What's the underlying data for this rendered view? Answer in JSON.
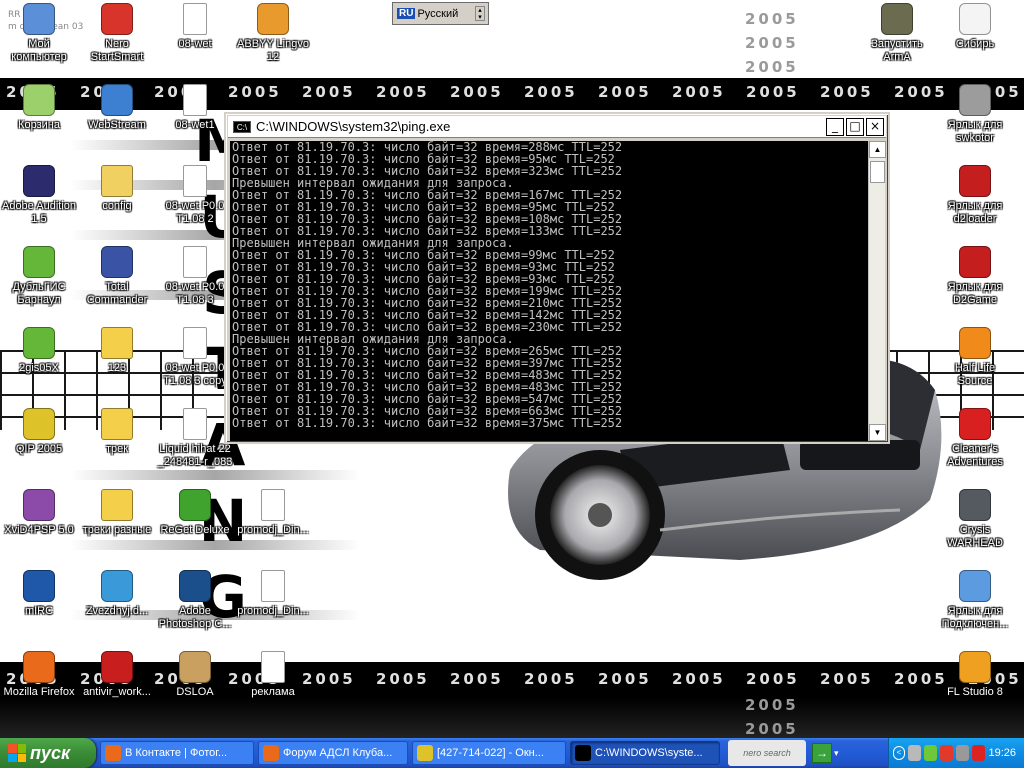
{
  "desktop": {
    "wallpaper": {
      "year_text": "2005",
      "mustang_letters": [
        "M",
        "U",
        "S",
        "T",
        "A",
        "N",
        "G"
      ],
      "corner_text_line1": "RR AZZO",
      "corner_text_line2": "m dof@drean 03"
    },
    "icons": [
      {
        "label": "Мой компьютер",
        "icon": "my-computer-icon"
      },
      {
        "label": "Nero StartSmart",
        "icon": "nero-icon"
      },
      {
        "label": "08-wet",
        "icon": "wav-file-icon"
      },
      {
        "label": "ABBYY Lingvo 12",
        "icon": "lingvo-books-icon"
      },
      {
        "label": "Запустить ArmA",
        "icon": "arma-soldier-icon"
      },
      {
        "label": "Сибирь",
        "icon": "sibir-game-icon"
      },
      {
        "label": "Корзина",
        "icon": "recycle-bin-icon"
      },
      {
        "label": "WebStream",
        "icon": "webstream-globe-icon"
      },
      {
        "label": "08-wet1",
        "icon": "wav-file-icon"
      },
      {
        "label": "Ярлык для swkotor",
        "icon": "kotor-icon"
      },
      {
        "label": "Adobe Audition 1.5",
        "icon": "audition-icon"
      },
      {
        "label": "config",
        "icon": "zip-folder-icon"
      },
      {
        "label": "08-wet P0.0 T1.08 2",
        "icon": "wav-file-icon"
      },
      {
        "label": "Ярлык для d2loader",
        "icon": "diablo-icon"
      },
      {
        "label": "ДубльГИС Барнаул",
        "icon": "dublgis-icon"
      },
      {
        "label": "Total Commander",
        "icon": "total-commander-icon"
      },
      {
        "label": "08-wet P0.0 T1.08 3",
        "icon": "wav-file-icon"
      },
      {
        "label": "Ярлык для D2Game",
        "icon": "diablo-icon"
      },
      {
        "label": "2gis05X",
        "icon": "dublgis-icon"
      },
      {
        "label": "123",
        "icon": "folder-icon"
      },
      {
        "label": "08-wet P0.0 T1.08 3 copy",
        "icon": "wav-file-icon"
      },
      {
        "label": "Half Life Source",
        "icon": "half-life-icon"
      },
      {
        "label": "QIP 2005",
        "icon": "qip-icon"
      },
      {
        "label": "трек",
        "icon": "folder-icon"
      },
      {
        "label": "Liquid hihat 22 _248481-r_083",
        "icon": "wav-file-icon"
      },
      {
        "label": "Cleaner's Adventures",
        "icon": "half-life-red-icon"
      },
      {
        "label": "XviD4PSP 5.0",
        "icon": "xvid-icon"
      },
      {
        "label": "треки разные",
        "icon": "folder-icon"
      },
      {
        "label": "ReGet Deluxe",
        "icon": "reget-icon"
      },
      {
        "label": "promodj_Din...",
        "icon": "mp3-file-icon"
      },
      {
        "label": "Crysis WARHEAD",
        "icon": "crysis-icon"
      },
      {
        "label": "mIRC",
        "icon": "mirc-icon"
      },
      {
        "label": "Zvezdnyj.d...",
        "icon": "disc-icon"
      },
      {
        "label": "Adobe Photoshop C...",
        "icon": "photoshop-icon"
      },
      {
        "label": "promodj_Din...",
        "icon": "document-icon"
      },
      {
        "label": "Ярлык для Подключен...",
        "icon": "network-connection-icon"
      },
      {
        "label": "Mozilla Firefox",
        "icon": "firefox-icon"
      },
      {
        "label": "antivir_work...",
        "icon": "antivir-icon"
      },
      {
        "label": "DSLOA",
        "icon": "dsloa-icon"
      },
      {
        "label": "реклама",
        "icon": "text-document-icon"
      },
      {
        "label": "FL Studio 8",
        "icon": "fl-studio-icon"
      }
    ]
  },
  "langbar": {
    "code": "RU",
    "label": "Русский"
  },
  "console": {
    "title": "C:\\WINDOWS\\system32\\ping.exe",
    "icon_text": "C:\\",
    "minimize": "_",
    "maximize": "□",
    "close": "×",
    "scroll_up": "▲",
    "scroll_down": "▼",
    "lines": [
      "Ответ от 81.19.70.3: число байт=32 время=288мс TTL=252",
      "Ответ от 81.19.70.3: число байт=32 время=95мс TTL=252",
      "Ответ от 81.19.70.3: число байт=32 время=323мс TTL=252",
      "Превышен интервал ожидания для запроса.",
      "Ответ от 81.19.70.3: число байт=32 время=167мс TTL=252",
      "Ответ от 81.19.70.3: число байт=32 время=95мс TTL=252",
      "Ответ от 81.19.70.3: число байт=32 время=108мс TTL=252",
      "Ответ от 81.19.70.3: число байт=32 время=133мс TTL=252",
      "Превышен интервал ожидания для запроса.",
      "Ответ от 81.19.70.3: число байт=32 время=99мс TTL=252",
      "Ответ от 81.19.70.3: число байт=32 время=93мс TTL=252",
      "Ответ от 81.19.70.3: число байт=32 время=93мс TTL=252",
      "Ответ от 81.19.70.3: число байт=32 время=199мс TTL=252",
      "Ответ от 81.19.70.3: число байт=32 время=210мс TTL=252",
      "Ответ от 81.19.70.3: число байт=32 время=142мс TTL=252",
      "Ответ от 81.19.70.3: число байт=32 время=230мс TTL=252",
      "Превышен интервал ожидания для запроса.",
      "Ответ от 81.19.70.3: число байт=32 время=265мс TTL=252",
      "Ответ от 81.19.70.3: число байт=32 время=397мс TTL=252",
      "Ответ от 81.19.70.3: число байт=32 время=483мс TTL=252",
      "Ответ от 81.19.70.3: число байт=32 время=483мс TTL=252",
      "Ответ от 81.19.70.3: число байт=32 время=547мс TTL=252",
      "Ответ от 81.19.70.3: число байт=32 время=663мс TTL=252",
      "Ответ от 81.19.70.3: число байт=32 время=375мс TTL=252"
    ]
  },
  "taskbar": {
    "start_label": "пуск",
    "tasks": [
      {
        "label": "В Контакте | Фотог...",
        "icon": "firefox-icon",
        "active": false
      },
      {
        "label": "Форум АДСЛ Клуба...",
        "icon": "firefox-icon",
        "active": false
      },
      {
        "label": "[427-714-022] - Окн...",
        "icon": "qip-chat-icon",
        "active": false
      },
      {
        "label": "C:\\WINDOWS\\syste...",
        "icon": "console-icon",
        "active": true
      }
    ],
    "nero_search_label": "nero search",
    "go_button": "→",
    "tray_collapse": "<",
    "clock": "19:26"
  },
  "colors": {
    "taskbar_blue": "#245edb",
    "start_green": "#3a8c36",
    "console_bg": "#000000",
    "console_text": "#c0c0c0",
    "tray_blue": "#0e8be3"
  }
}
